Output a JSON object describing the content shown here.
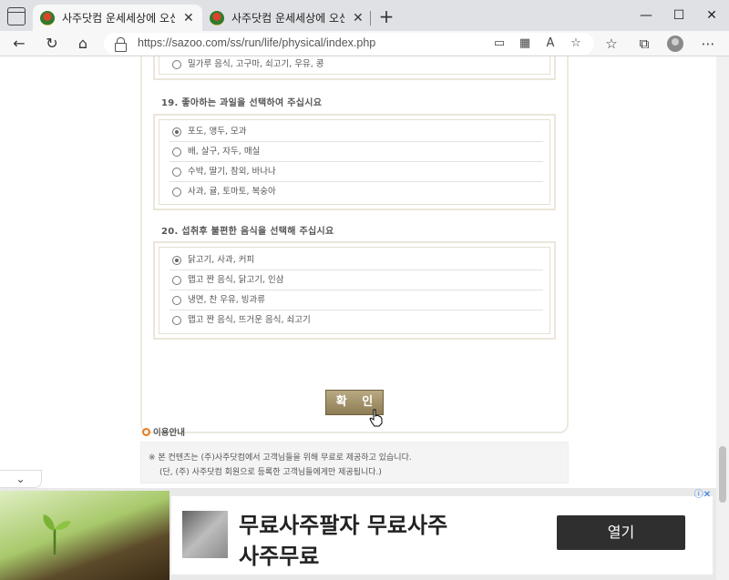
{
  "browser": {
    "tabs": [
      {
        "title": "사주닷컴 운세세상에 오신것을 환영합니다",
        "active": true
      },
      {
        "title": "사주닷컴 운세세상에 오신것을 환영합니다",
        "active": false
      }
    ],
    "url": "https://sazoo.com/ss/run/life/physical/index.php",
    "close_glyph": "✕",
    "new_tab_glyph": "+",
    "window_controls": {
      "minimize": "—",
      "maximize": "☐",
      "close": "✕"
    }
  },
  "page": {
    "prev_option": "밀가루 음식, 고구마, 쇠고기, 우유, 콩",
    "questions": [
      {
        "title": "19. 좋아하는 과일을 선택하여 주십시요",
        "options": [
          "포도, 앵두, 모과",
          "배, 살구, 자두, 매실",
          "수박, 딸기, 참외, 바나나",
          "사과, 귤, 토마토, 복숭아"
        ],
        "selected_index": 0
      },
      {
        "title": "20. 섭취후 불편한 음식을 선택해 주십시요",
        "options": [
          "닭고기, 사과, 커피",
          "맵고 짠 음식, 닭고기, 인삼",
          "냉면, 찬 우유, 빙과류",
          "맵고 짠 음식, 뜨거운 음식, 쇠고기"
        ],
        "selected_index": 0
      }
    ],
    "confirm_label": "확 인",
    "info": {
      "heading": "이용안내",
      "line1": "※ 본 컨텐츠는 (주)사주닷컴에서 고객님들을 위해 무료로 제공하고 있습니다.",
      "line2": "(단, (주) 사주닷컴 회원으로 등록한 고객님들에게만 제공됩니다.)"
    }
  },
  "ad": {
    "line1": "무료사주팔자 무료사주",
    "line2": "사주무료",
    "button": "열기",
    "choices_icon": "ⓘ✕"
  },
  "colors": {
    "accent_orange": "#e67c1a",
    "button_gold": "#a8976c",
    "ad_button": "#2f2f2f"
  }
}
